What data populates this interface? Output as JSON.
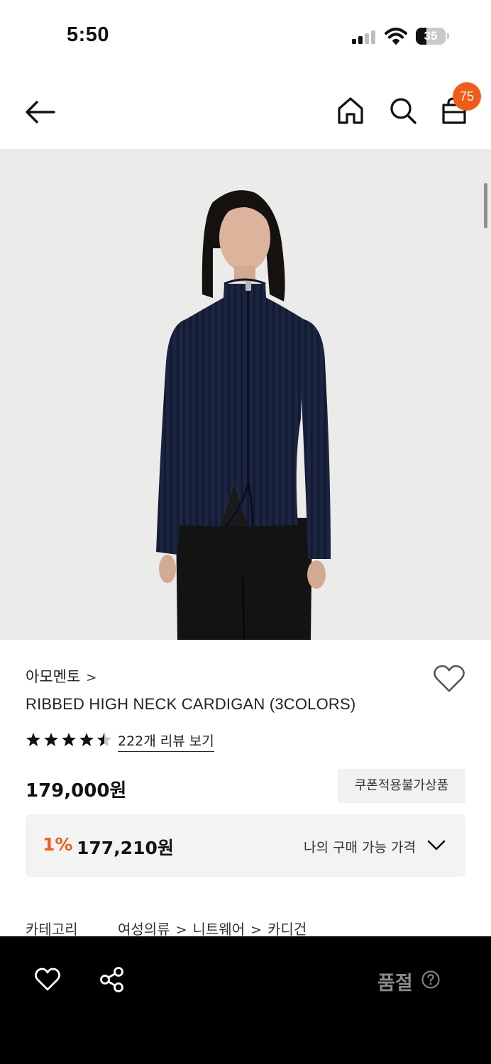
{
  "status_bar": {
    "time": "5:50",
    "battery_level": "35",
    "battery_fraction": 0.35,
    "icons": [
      "signal-icon",
      "wifi-icon",
      "battery-icon"
    ]
  },
  "nav": {
    "icons": [
      "back-arrow-icon",
      "home-icon",
      "search-icon",
      "shopping-bag-icon"
    ],
    "cart_count": "75"
  },
  "product": {
    "image_subject": "model wearing navy ribbed high neck zip cardigan",
    "brand": "아모멘토",
    "brand_chevron": ">",
    "name": "RIBBED HIGH NECK CARDIGAN (3COLORS)",
    "rating_stars": 4.5,
    "review_link": "222개 리뷰 보기",
    "price": "179,000원",
    "coupon_note": "쿠폰적용불가상품",
    "member_price": {
      "discount": "1%",
      "price": "177,210원",
      "label": "나의 구매 가능 가격"
    },
    "category": {
      "label": "카테고리",
      "path": [
        "여성의류",
        "니트웨어",
        "카디건"
      ],
      "separator": ">"
    }
  },
  "bottom_bar": {
    "soldout_label": "품절",
    "icons": [
      "heart-icon",
      "share-icon",
      "help-icon"
    ]
  },
  "colors": {
    "accent": "#f25c19",
    "bottom_bar_bg": "#000000",
    "image_bg": "#ebebea",
    "cardigan_navy": "#1b2440"
  }
}
